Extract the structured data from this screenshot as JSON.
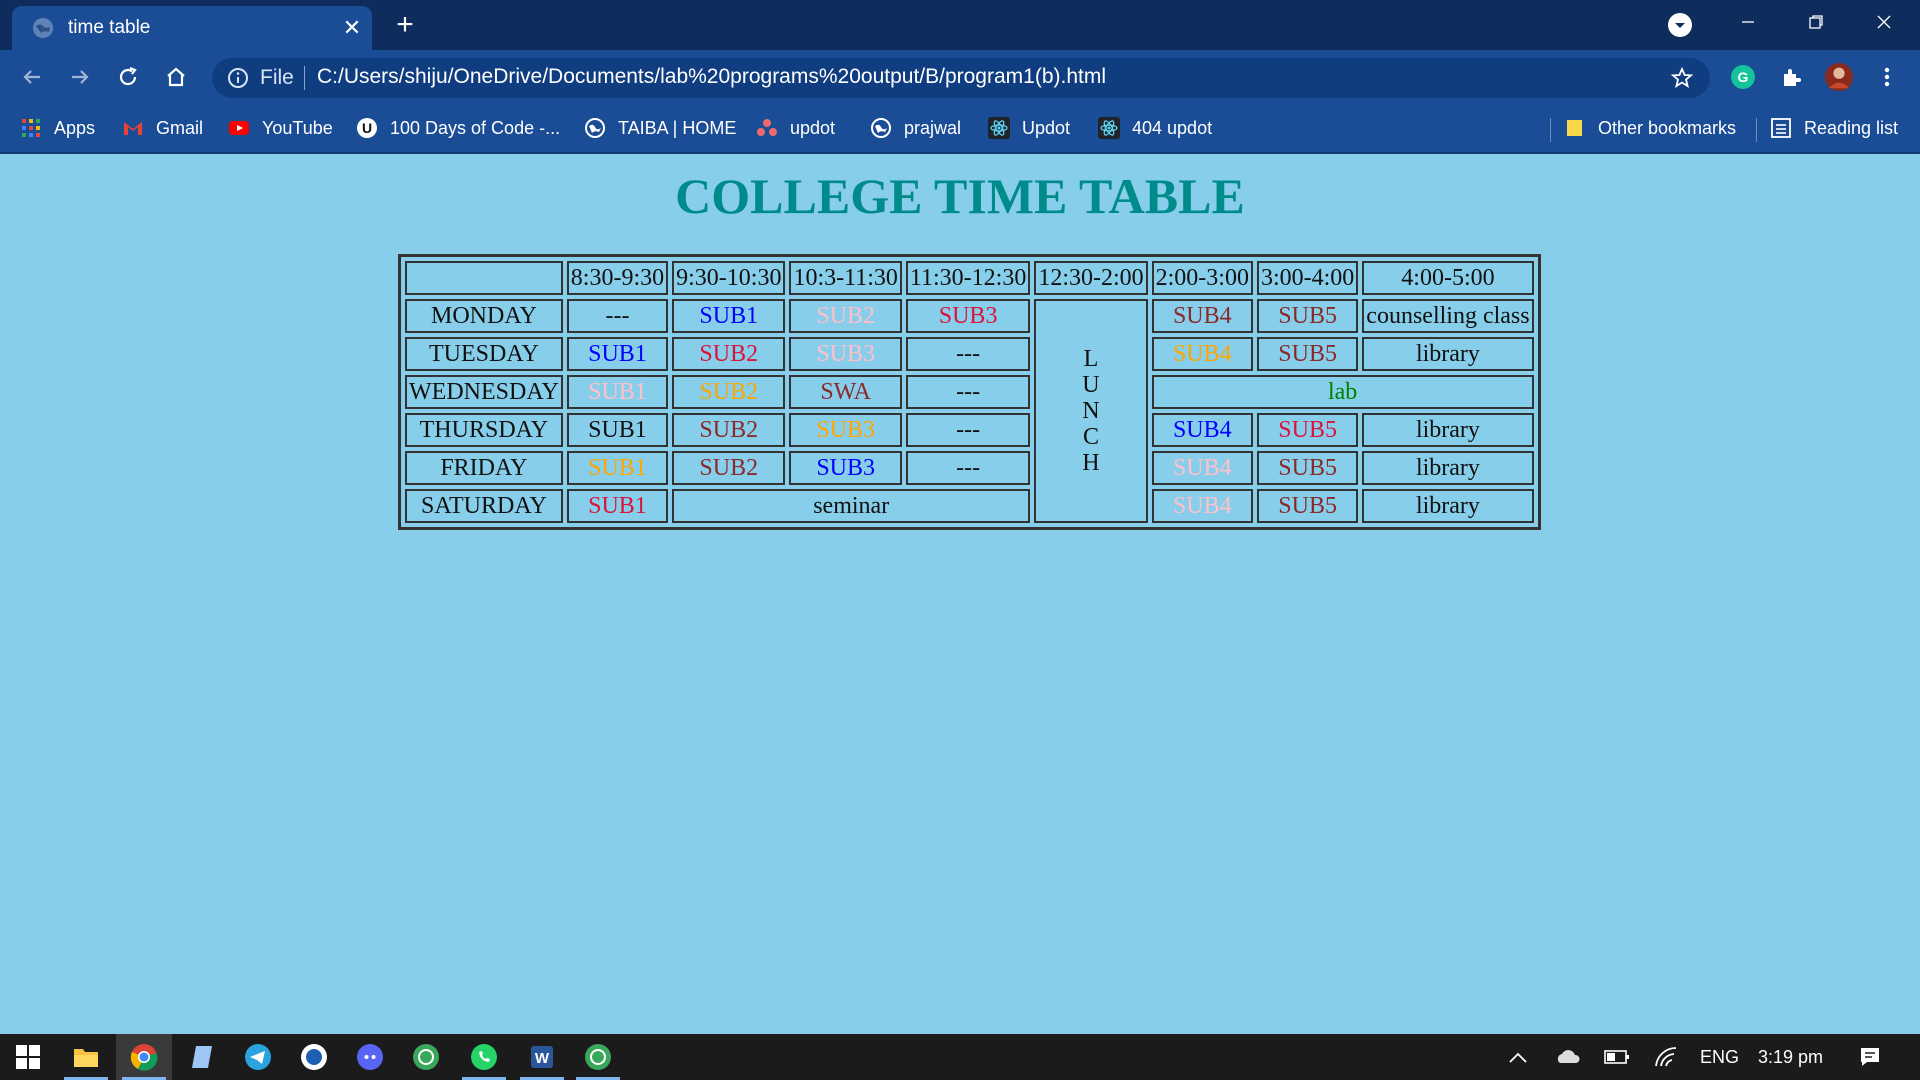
{
  "browser": {
    "tab_title": "time table",
    "omnibox_scheme": "File",
    "url": "C:/Users/shiju/OneDrive/Documents/lab%20programs%20output/B/program1(b).html",
    "bookmarks": [
      {
        "label": "Apps",
        "icon": "apps-grid-icon"
      },
      {
        "label": "Gmail",
        "icon": "gmail-icon"
      },
      {
        "label": "YouTube",
        "icon": "youtube-icon"
      },
      {
        "label": "100 Days of Code -...",
        "icon": "u-icon"
      },
      {
        "label": "TAIBA | HOME",
        "icon": "globe-icon"
      },
      {
        "label": "updot",
        "icon": "asana-icon"
      },
      {
        "label": "prajwal",
        "icon": "globe-icon"
      },
      {
        "label": "Updot",
        "icon": "react-icon"
      },
      {
        "label": "404 updot",
        "icon": "react-icon"
      }
    ],
    "other_bookmarks": "Other bookmarks",
    "reading_list": "Reading list"
  },
  "page": {
    "heading": "COLLEGE TIME TABLE",
    "header_row": [
      "",
      "8:30-9:30",
      "9:30-10:30",
      "10:3-11:30",
      "11:30-12:30",
      "12:30-2:00",
      "2:00-3:00",
      "3:00-4:00",
      "4:00-5:00"
    ],
    "lunch_letters": [
      "L",
      "U",
      "N",
      "C",
      "H"
    ],
    "rows": [
      {
        "day": "MONDAY",
        "morning": [
          {
            "t": "---",
            "c": "black"
          },
          {
            "t": "SUB1",
            "c": "blue"
          },
          {
            "t": "SUB2",
            "c": "pink"
          },
          {
            "t": "SUB3",
            "c": "red"
          }
        ],
        "afternoon": [
          {
            "t": "SUB4",
            "c": "brown"
          },
          {
            "t": "SUB5",
            "c": "brown"
          },
          {
            "t": "counselling class",
            "c": "black"
          }
        ]
      },
      {
        "day": "TUESDAY",
        "morning": [
          {
            "t": "SUB1",
            "c": "blue"
          },
          {
            "t": "SUB2",
            "c": "red"
          },
          {
            "t": "SUB3",
            "c": "pink"
          },
          {
            "t": "---",
            "c": "black"
          }
        ],
        "afternoon": [
          {
            "t": "SUB4",
            "c": "orange"
          },
          {
            "t": "SUB5",
            "c": "brown"
          },
          {
            "t": "library",
            "c": "black"
          }
        ]
      },
      {
        "day": "WEDNESDAY",
        "morning": [
          {
            "t": "SUB1",
            "c": "pink"
          },
          {
            "t": "SUB2",
            "c": "orange"
          },
          {
            "t": "SWA",
            "c": "brown"
          },
          {
            "t": "---",
            "c": "black"
          }
        ],
        "afternoon_merged": {
          "t": "lab",
          "c": "green"
        }
      },
      {
        "day": "THURSDAY",
        "morning": [
          {
            "t": "SUB1",
            "c": "black"
          },
          {
            "t": "SUB2",
            "c": "brown"
          },
          {
            "t": "SUB3",
            "c": "orange"
          },
          {
            "t": "---",
            "c": "black"
          }
        ],
        "afternoon": [
          {
            "t": "SUB4",
            "c": "blue"
          },
          {
            "t": "SUB5",
            "c": "red"
          },
          {
            "t": "library",
            "c": "black"
          }
        ]
      },
      {
        "day": "FRIDAY",
        "morning": [
          {
            "t": "SUB1",
            "c": "orange"
          },
          {
            "t": "SUB2",
            "c": "brown"
          },
          {
            "t": "SUB3",
            "c": "blue"
          },
          {
            "t": "---",
            "c": "black"
          }
        ],
        "afternoon": [
          {
            "t": "SUB4",
            "c": "pink"
          },
          {
            "t": "SUB5",
            "c": "brown"
          },
          {
            "t": "library",
            "c": "black"
          }
        ]
      },
      {
        "day": "SATURDAY",
        "morning_first": {
          "t": "SUB1",
          "c": "red"
        },
        "morning_merged": {
          "t": "seminar",
          "c": "black"
        },
        "afternoon": [
          {
            "t": "SUB4",
            "c": "pink"
          },
          {
            "t": "SUB5",
            "c": "brown"
          },
          {
            "t": "library",
            "c": "black"
          }
        ]
      }
    ]
  },
  "taskbar": {
    "apps": [
      "windows-start-icon",
      "file-explorer-icon",
      "chrome-icon",
      "notes-icon",
      "telegram-icon",
      "whiteboard-icon",
      "discord-icon",
      "app-green-icon",
      "whatsapp-icon",
      "word-icon",
      "app-green-icon"
    ],
    "lang": "ENG",
    "time": "3:19 pm"
  },
  "colors": {
    "page_bg": "#87ceeb",
    "heading": "#008b8b",
    "chrome_frame": "#0f2d5c",
    "chrome_toolbar": "#1a4d96"
  }
}
